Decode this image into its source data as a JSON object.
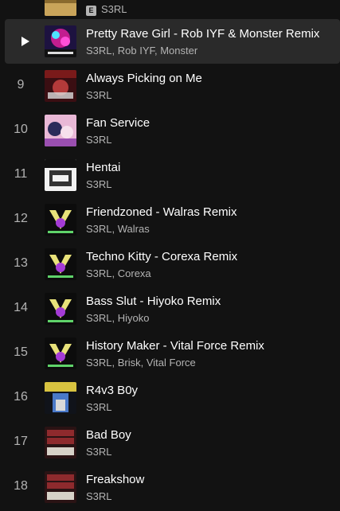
{
  "tracks": [
    {
      "number": "",
      "title": "",
      "artists": "S3RL",
      "explicit": "E",
      "art": "gold"
    },
    {
      "number": "",
      "title": "Pretty Rave Girl - Rob IYF & Monster Remix",
      "artists": "S3RL, Rob IYF, Monster",
      "active": true,
      "art": "rave"
    },
    {
      "number": "9",
      "title": "Always Picking on Me",
      "artists": "S3RL",
      "art": "picking"
    },
    {
      "number": "10",
      "title": "Fan Service",
      "artists": "S3RL",
      "art": "fanservice"
    },
    {
      "number": "11",
      "title": "Hentai",
      "artists": "S3RL",
      "art": "hentai"
    },
    {
      "number": "12",
      "title": "Friendzoned - Walras Remix",
      "artists": "S3RL, Walras",
      "art": "remix"
    },
    {
      "number": "13",
      "title": "Techno Kitty - Corexa Remix",
      "artists": "S3RL, Corexa",
      "art": "remix"
    },
    {
      "number": "14",
      "title": "Bass Slut - Hiyoko Remix",
      "artists": "S3RL, Hiyoko",
      "art": "remix"
    },
    {
      "number": "15",
      "title": "History Maker - Vital Force Remix",
      "artists": "S3RL, Brisk, Vital Force",
      "art": "remix"
    },
    {
      "number": "16",
      "title": "R4v3 B0y",
      "artists": "S3RL",
      "art": "raveboy"
    },
    {
      "number": "17",
      "title": "Bad Boy",
      "artists": "S3RL",
      "art": "oldskool"
    },
    {
      "number": "18",
      "title": "Freakshow",
      "artists": "S3RL",
      "art": "oldskool"
    }
  ],
  "icons": {
    "play": "play-icon",
    "explicit_badge": "explicit-badge"
  },
  "colors": {
    "background": "#121212",
    "active_row": "#2a2a2a",
    "text": "#ffffff",
    "muted": "#b3b3b3"
  }
}
